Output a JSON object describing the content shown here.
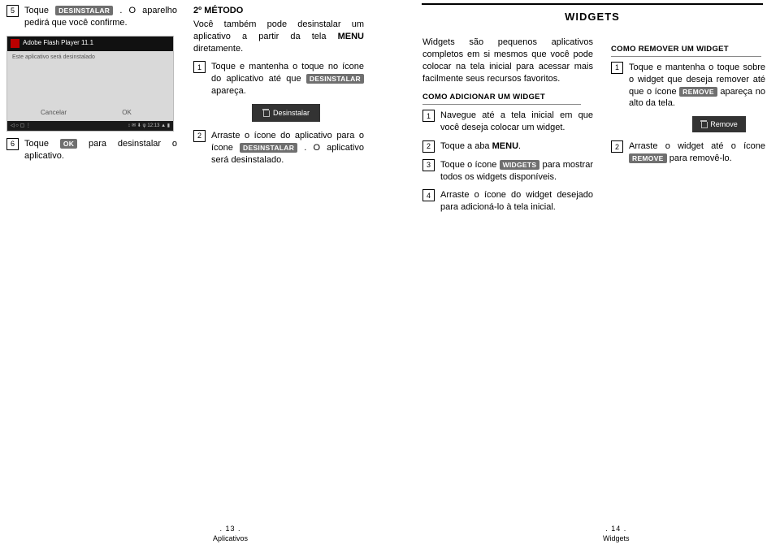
{
  "col1": {
    "step5_a": "Toque ",
    "step5_pill": "DESINSTALAR",
    "step5_b": ". O aparelho pedirá que você confirme.",
    "ss": {
      "title": "Adobe Flash Player 11.1",
      "line2": "Este aplicativo será desinstalado",
      "cancel": "Cancelar",
      "ok": "OK",
      "time": "12:13"
    },
    "step6_a": "Toque ",
    "step6_pill": "OK",
    "step6_b": " para desinstalar o aplicativo."
  },
  "col2": {
    "method_title": "2º MÉTODO",
    "intro_a": "Você também pode desinstalar um aplicativo a partir da tela ",
    "intro_b": "MENU",
    "intro_c": " diretamente.",
    "step1_a": "Toque e mantenha o toque no ícone do aplicativo até que ",
    "step1_pill": "DESINSTALAR",
    "step1_b": " apareça.",
    "btn": "Desinstalar",
    "step2_a": "Arraste o ícone do aplicativo para o ícone ",
    "step2_pill": "DESINSTALAR",
    "step2_b": ". O aplicativo será desinstalado."
  },
  "widgets_title": "WIDGETS",
  "col3": {
    "intro": "Widgets são pequenos aplicativos completos em si mesmos que você pode colocar na tela inicial para acessar mais facilmente seus recursos favoritos.",
    "hd_add": "COMO ADICIONAR UM WIDGET",
    "s1": "Navegue até a tela inicial em que você deseja colocar um widget.",
    "s2_a": "Toque a aba ",
    "s2_b": "MENU",
    "s2_c": ".",
    "s3_a": "Toque o ícone ",
    "s3_pill": "WIDGETS",
    "s3_b": " para mostrar todos os widgets disponíveis.",
    "s4": "Arraste o ícone do widget desejado para adicioná-lo à tela inicial."
  },
  "col4": {
    "hd_rem": "COMO REMOVER UM WIDGET",
    "s1_a": "Toque e mantenha o toque sobre o widget que deseja remover até que o ícone ",
    "s1_pill": "REMOVE",
    "s1_b": " apareça no alto da tela.",
    "btn": "Remove",
    "s2_a": "Arraste o widget até o ícone ",
    "s2_pill": "REMOVE",
    "s2_b": " para removê-lo."
  },
  "footer": {
    "p13_num": ". 13 .",
    "p13_lbl": "Aplicativos",
    "p14_num": ". 14 .",
    "p14_lbl": "Widgets"
  }
}
